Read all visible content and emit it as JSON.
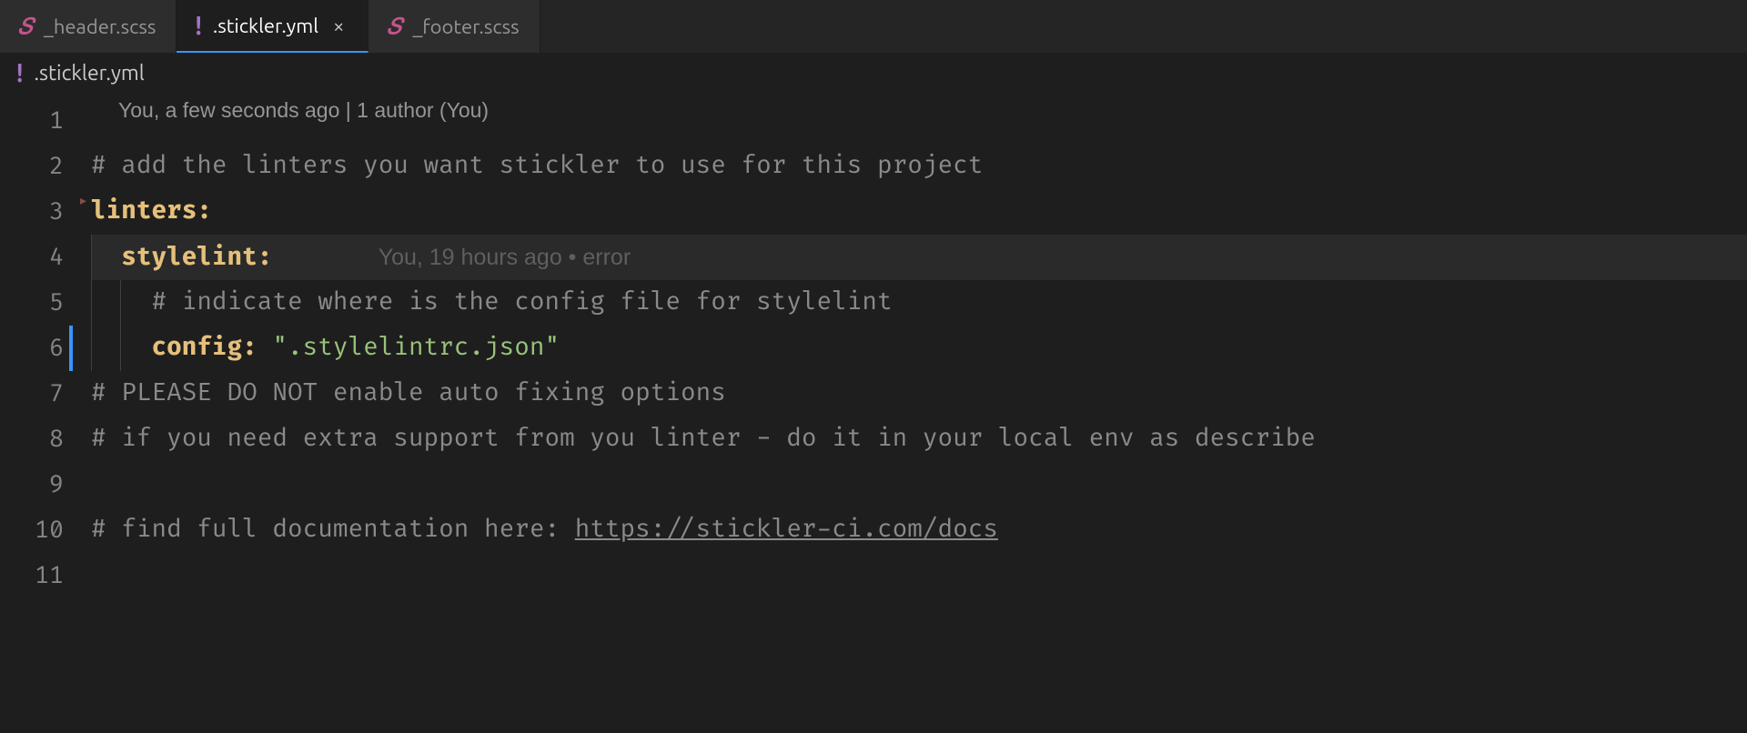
{
  "tabs": [
    {
      "label": "_header.scss",
      "type": "scss",
      "active": false
    },
    {
      "label": ".stickler.yml",
      "type": "yml",
      "active": true
    },
    {
      "label": "_footer.scss",
      "type": "scss",
      "active": false
    }
  ],
  "breadcrumb": {
    "file": ".stickler.yml",
    "type": "yml"
  },
  "codelens": "You, a few seconds ago | 1 author (You)",
  "inline_blame": "You, 19 hours ago • error",
  "lines": {
    "count": 11,
    "l1": "# add the linters you want stickler to use for this project",
    "l2_key": "linters:",
    "l3_key": "stylelint:",
    "l4": "# indicate where is the config file for stylelint",
    "l5_key": "config:",
    "l5_val": "\".stylelintrc.json\"",
    "l6": "# PLEASE DO NOT enable auto fixing options",
    "l7": "# if you need extra support from you linter - do it in your local env as describe",
    "l9a": "# find full documentation here: ",
    "l9b": "https://stickler-ci.com/docs"
  }
}
